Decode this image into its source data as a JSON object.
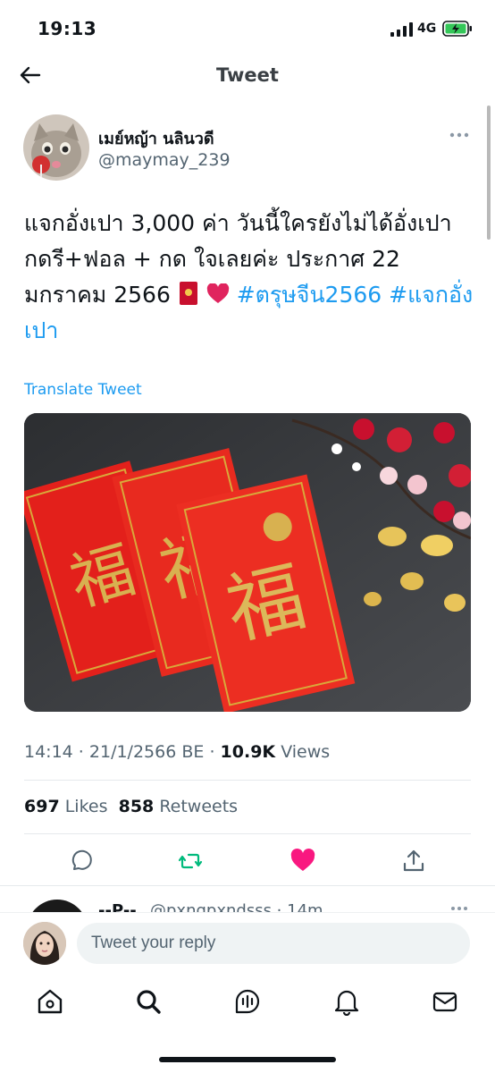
{
  "status_bar": {
    "time": "19:13",
    "network": "4G"
  },
  "header": {
    "title": "Tweet",
    "back_icon": "arrow-left-icon"
  },
  "tweet": {
    "display_name": "เมย์หญ้า นลินวดี",
    "handle": "@maymay_239",
    "text_before": "แจกอั่งเปา 3,000 ค่า วันนี้ใครยังไม่ได้อั่งเปา กดรี+ฟอล + กด ใจเลยค่ะ ประกาศ 22 มกราคม 2566",
    "emojis": [
      "red-envelope-emoji",
      "red-heart-emoji"
    ],
    "hashtags": [
      "#ตรุษจีน2566",
      "#แจกอั่งเปา"
    ],
    "translate_label": "Translate Tweet",
    "time": "14:14",
    "date": "21/1/2566 BE",
    "views_count": "10.9K",
    "views_label": "Views",
    "likes_count": "697",
    "likes_label": "Likes",
    "retweets_count": "858",
    "retweets_label": "Retweets"
  },
  "actions": [
    "reply-icon",
    "retweet-icon",
    "like-icon",
    "share-icon"
  ],
  "reply_preview": {
    "name": "--P--",
    "handle_time": "@pxngpxndsss · 14m"
  },
  "compose": {
    "placeholder": "Tweet your reply"
  },
  "tab_bar": [
    "home-icon",
    "search-icon",
    "spaces-icon",
    "notifications-icon",
    "messages-icon"
  ],
  "colors": {
    "accent": "#1d9bf0",
    "retweet_green": "#00ba7c",
    "like_pink": "#f91880",
    "secondary_text": "#536471"
  }
}
